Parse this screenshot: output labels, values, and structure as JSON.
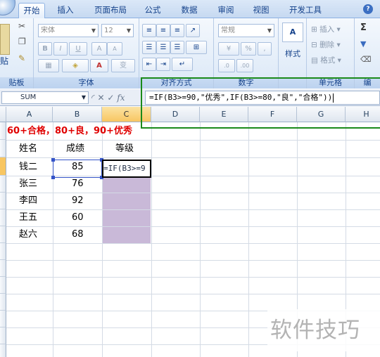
{
  "ribbon_tabs": [
    "开始",
    "插入",
    "页面布局",
    "公式",
    "数据",
    "审阅",
    "视图",
    "开发工具"
  ],
  "help_icon": "help-icon",
  "groups": {
    "clipboard": {
      "label": "贴板",
      "paste_label": "贴"
    },
    "font": {
      "label": "字体",
      "font_name": "宋体",
      "font_size": "12",
      "bold": "B",
      "italic": "I",
      "underline": "U",
      "grow": "A",
      "shrink": "A",
      "wen": "变"
    },
    "alignment": {
      "label": "对齐方式"
    },
    "number": {
      "label": "数字",
      "format": "常规",
      "percent": "%",
      "comma": ","
    },
    "styles": {
      "label": "",
      "button": "样式"
    },
    "cells": {
      "label": "单元格",
      "insert": "插入",
      "delete": "删除",
      "format": "格式"
    },
    "editing": {
      "label": "编",
      "sum": "Σ"
    }
  },
  "formula_bar": {
    "name_box": "SUM",
    "formula_text": "=IF(B3>=90,\"优秀\",IF(B3>=80,\"良\",\"合格\"))"
  },
  "columns": [
    "A",
    "B",
    "C",
    "D",
    "E",
    "F",
    "G",
    "H"
  ],
  "sheet": {
    "title_row": "60+合格，80+良，90+优秀",
    "headers": {
      "name": "姓名",
      "score": "成绩",
      "grade": "等级"
    },
    "rows": [
      {
        "name": "钱二",
        "score": "85"
      },
      {
        "name": "张三",
        "score": "76"
      },
      {
        "name": "李四",
        "score": "92"
      },
      {
        "name": "王五",
        "score": "60"
      },
      {
        "name": "赵六",
        "score": "68"
      }
    ],
    "active_cell_text": "=IF(B3>=9"
  },
  "watermark": "软件技巧",
  "colors": {
    "accent": "#15428b",
    "highlight_box": "#1a8a1a",
    "title_red": "#e00000",
    "grade_fill": "#c9b9d8",
    "selected_header": "#f8c662"
  }
}
